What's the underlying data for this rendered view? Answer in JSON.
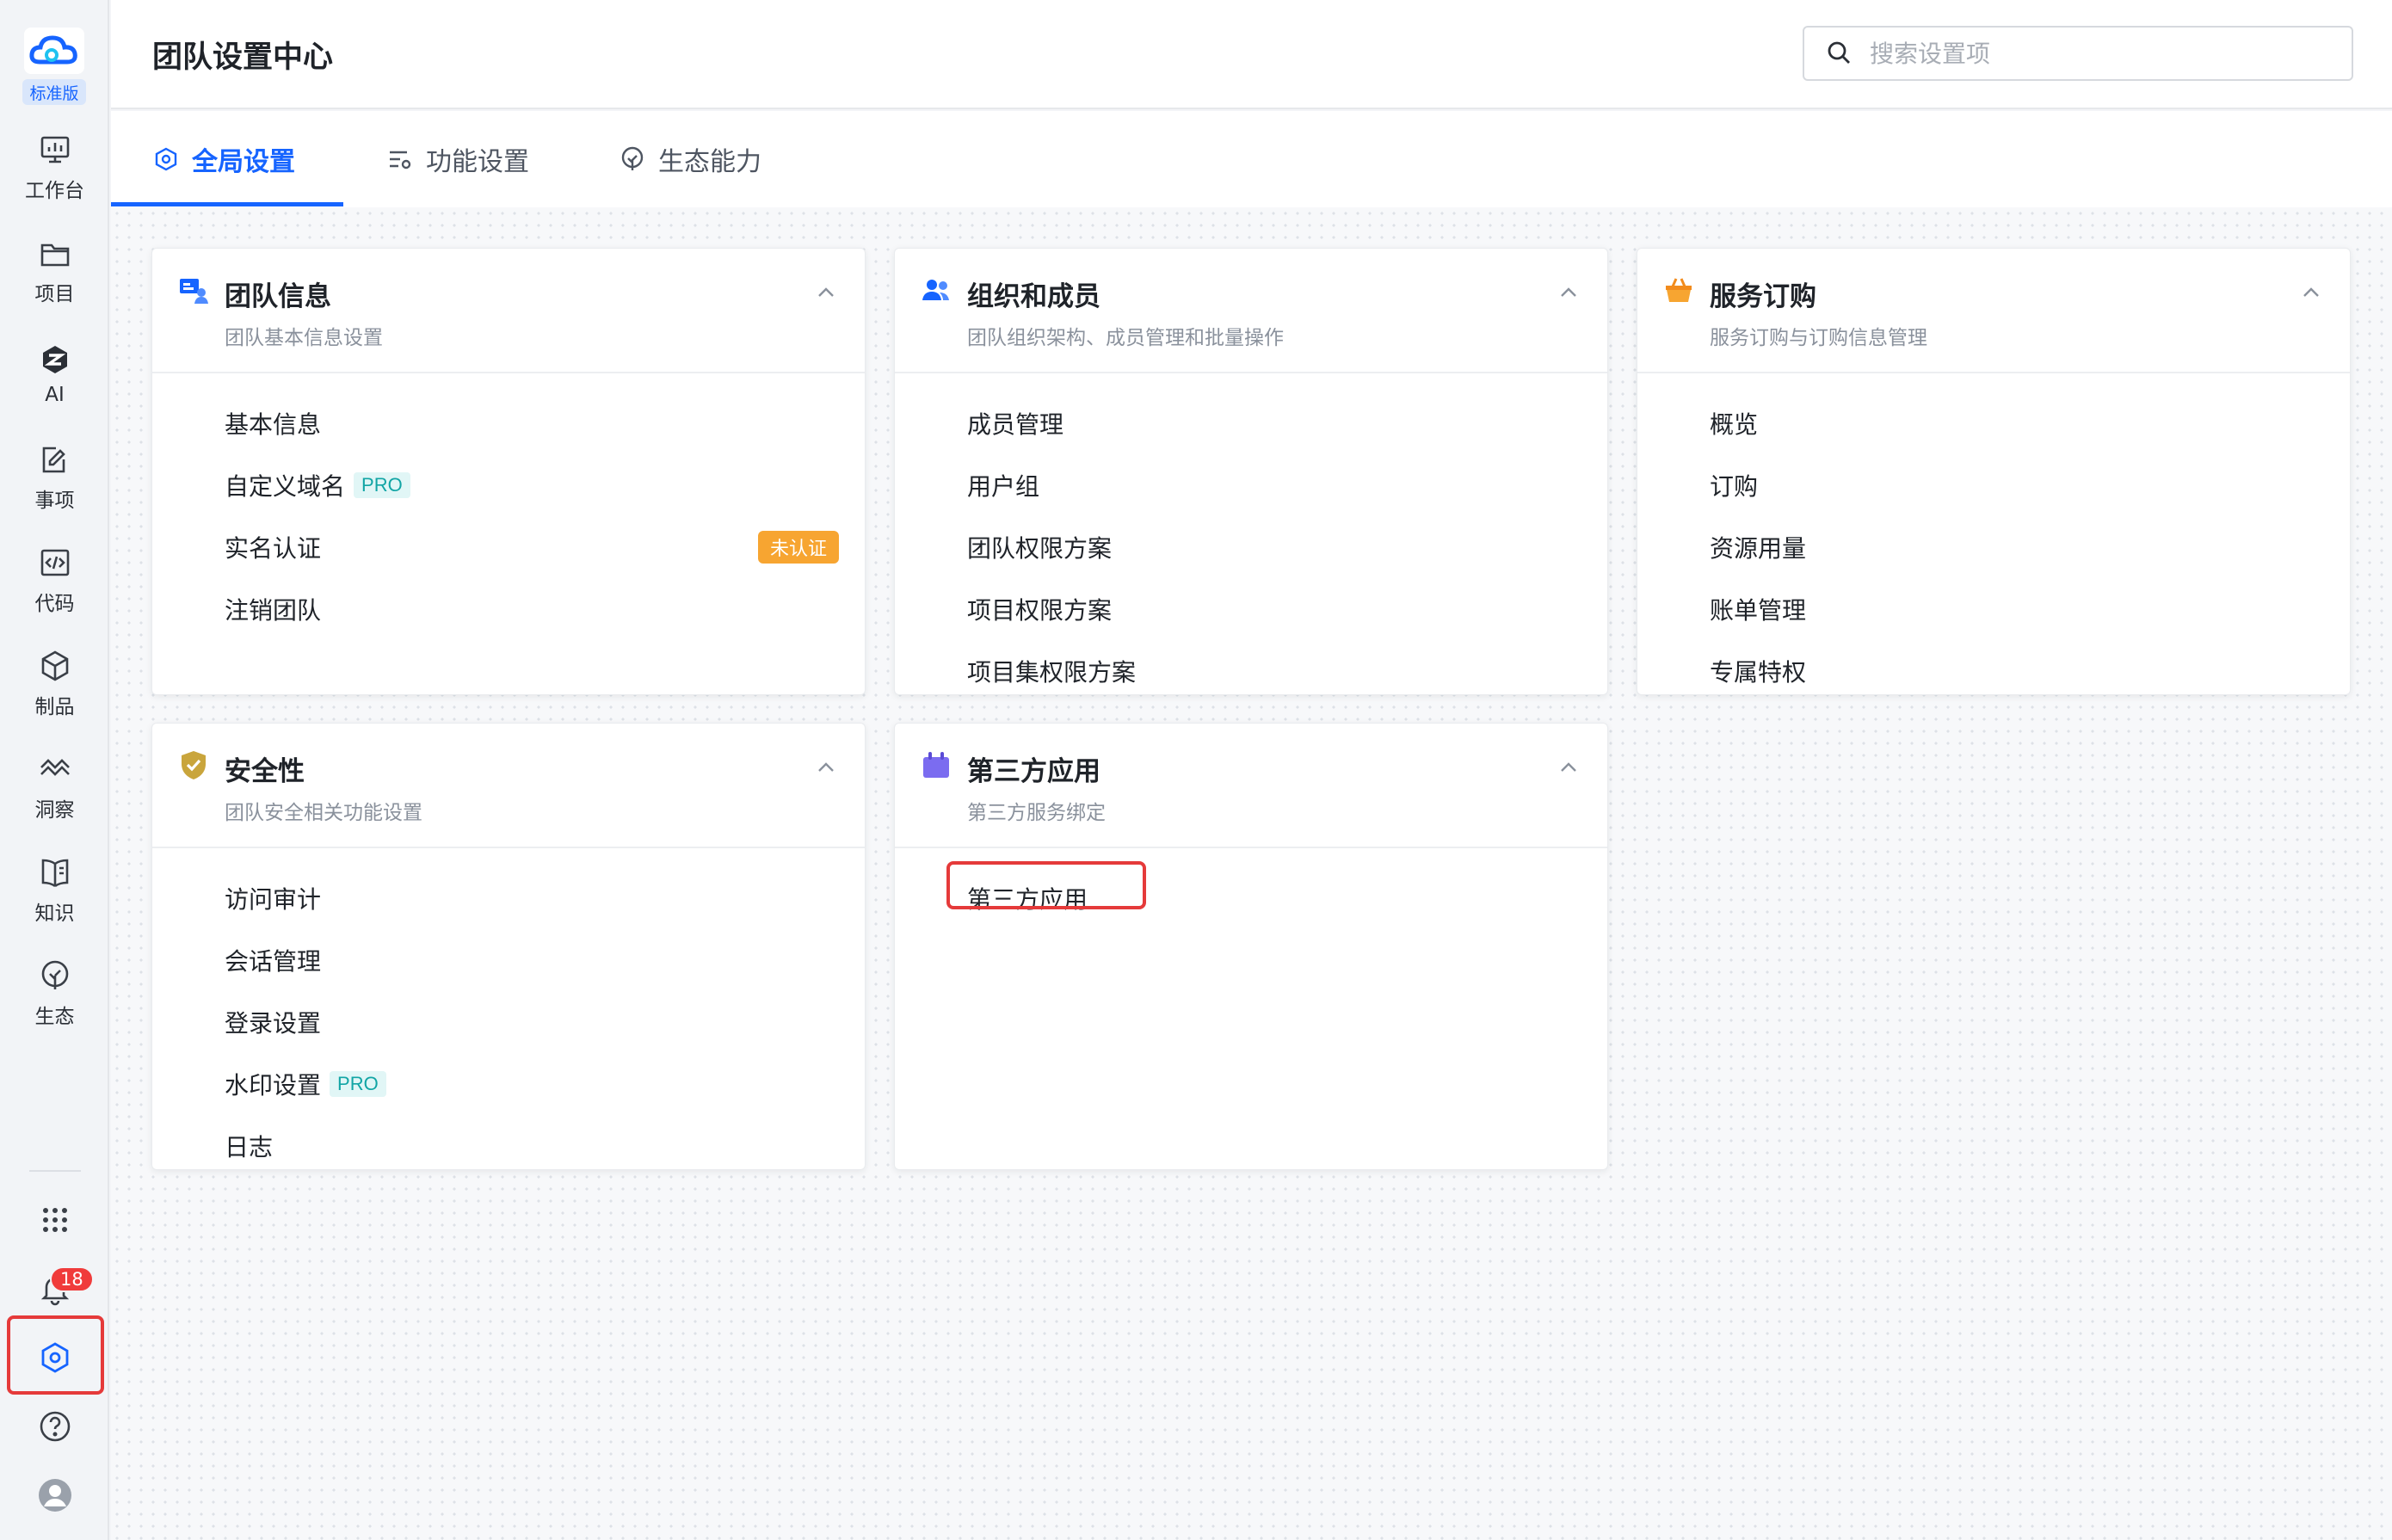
{
  "app": {
    "edition_label": "标准版",
    "page_title": "团队设置中心"
  },
  "colors": {
    "accent": "#1664ff",
    "highlight": "#e53a3a",
    "pro_tag": "#12a5a5",
    "warning": "#f7a531"
  },
  "sidebar": {
    "items": [
      {
        "label": "工作台",
        "icon": "dashboard-icon"
      },
      {
        "label": "项目",
        "icon": "folder-icon"
      },
      {
        "label": "AI",
        "icon": "ai-icon"
      },
      {
        "label": "事项",
        "icon": "task-icon"
      },
      {
        "label": "代码",
        "icon": "code-icon"
      },
      {
        "label": "制品",
        "icon": "package-icon"
      },
      {
        "label": "洞察",
        "icon": "insight-icon"
      },
      {
        "label": "知识",
        "icon": "book-icon"
      },
      {
        "label": "生态",
        "icon": "ecosystem-icon"
      }
    ],
    "notification_count": "18",
    "bottom_icons": [
      "apps-grid-icon",
      "bell-icon",
      "settings-icon",
      "help-icon",
      "avatar-icon"
    ]
  },
  "search": {
    "placeholder": "搜索设置项",
    "value": ""
  },
  "tabs": [
    {
      "label": "全局设置",
      "active": true,
      "icon": "hexagon-settings-icon"
    },
    {
      "label": "功能设置",
      "active": false,
      "icon": "list-settings-icon"
    },
    {
      "label": "生态能力",
      "active": false,
      "icon": "tree-icon"
    }
  ],
  "cards": {
    "team_info": {
      "title": "团队信息",
      "subtitle": "团队基本信息设置",
      "items": [
        {
          "label": "基本信息"
        },
        {
          "label": "自定义域名",
          "tag": "PRO"
        },
        {
          "label": "实名认证",
          "status": "未认证"
        },
        {
          "label": "注销团队"
        }
      ]
    },
    "org_members": {
      "title": "组织和成员",
      "subtitle": "团队组织架构、成员管理和批量操作",
      "items": [
        {
          "label": "成员管理"
        },
        {
          "label": "用户组"
        },
        {
          "label": "团队权限方案"
        },
        {
          "label": "项目权限方案"
        },
        {
          "label": "项目集权限方案"
        }
      ]
    },
    "subscription": {
      "title": "服务订购",
      "subtitle": "服务订购与订购信息管理",
      "items": [
        {
          "label": "概览"
        },
        {
          "label": "订购"
        },
        {
          "label": "资源用量"
        },
        {
          "label": "账单管理"
        },
        {
          "label": "专属特权"
        }
      ]
    },
    "security": {
      "title": "安全性",
      "subtitle": "团队安全相关功能设置",
      "items": [
        {
          "label": "访问审计"
        },
        {
          "label": "会话管理"
        },
        {
          "label": "登录设置"
        },
        {
          "label": "水印设置",
          "tag": "PRO"
        },
        {
          "label": "日志"
        }
      ]
    },
    "third_party": {
      "title": "第三方应用",
      "subtitle": "第三方服务绑定",
      "items": [
        {
          "label": "第三方应用"
        }
      ]
    }
  }
}
